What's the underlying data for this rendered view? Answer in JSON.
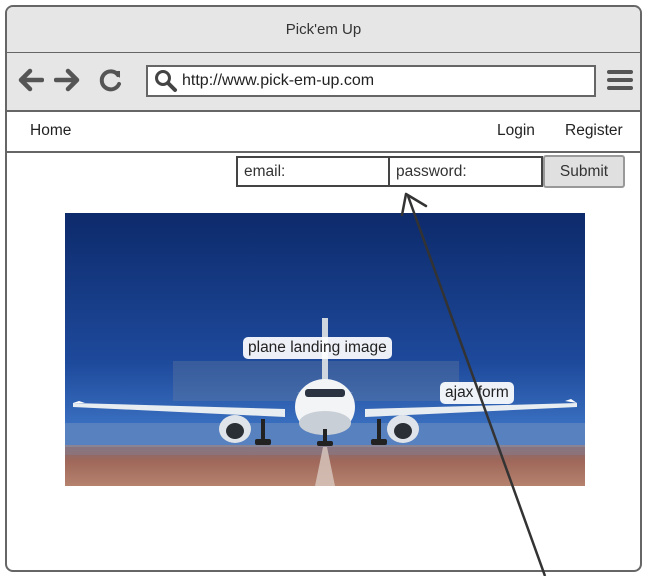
{
  "window": {
    "title": "Pick'em Up"
  },
  "toolbar": {
    "back_icon": "back-arrow-icon",
    "forward_icon": "forward-arrow-icon",
    "reload_icon": "reload-icon",
    "url": "http://www.pick-em-up.com",
    "search_icon": "search-icon",
    "menu_icon": "hamburger-menu-icon"
  },
  "nav": {
    "home": "Home",
    "login": "Login",
    "register": "Register"
  },
  "login_form": {
    "email_label": "email:",
    "password_label": "password:",
    "submit_label": "Submit"
  },
  "annotations": {
    "image_label": "plane landing image",
    "form_label": "ajax form"
  },
  "colors": {
    "chrome": "#e6e6e6",
    "border": "#666666",
    "sky_top": "#0d2a6b",
    "sky_bottom": "#2f64b8",
    "runway": "#a0685a"
  }
}
